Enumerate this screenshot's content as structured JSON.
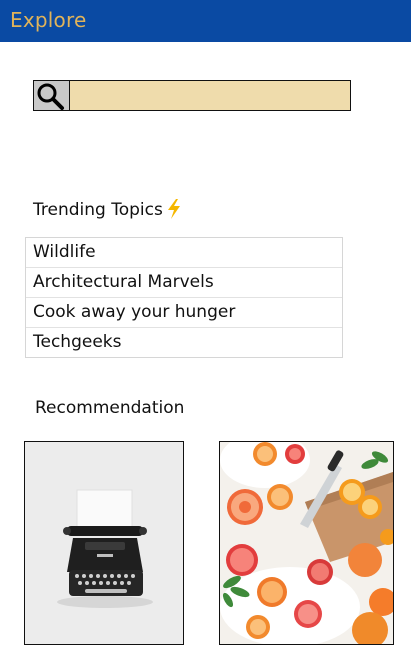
{
  "header": {
    "title": "Explore"
  },
  "search": {
    "icon": "search-icon",
    "value": "",
    "placeholder": ""
  },
  "trending": {
    "heading": "Trending Topics",
    "icon": "lightning-bolt-icon",
    "items": [
      {
        "label": "Wildlife"
      },
      {
        "label": "Architectural Marvels"
      },
      {
        "label": "Cook away your hunger"
      },
      {
        "label": "Techgeeks"
      }
    ]
  },
  "recommendation": {
    "heading": "Recommendation",
    "cards": [
      {
        "image": "typewriter-photo"
      },
      {
        "image": "citrus-fruits-photo"
      }
    ]
  },
  "colors": {
    "appbar": "#0a4aa3",
    "title": "#e0b35a",
    "search_field": "#efdcac",
    "search_button": "#c9c9c9",
    "bolt": "#f5b700"
  }
}
